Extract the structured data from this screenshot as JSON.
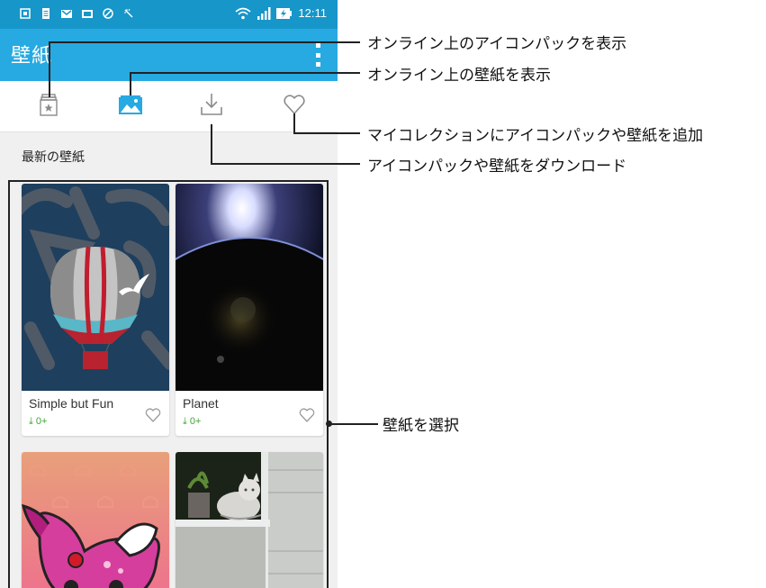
{
  "status_bar": {
    "time": "12:11",
    "icons": [
      "screenshot-icon",
      "doc-icon",
      "gmail-icon",
      "mail-icon",
      "dnd-icon",
      "clean-icon",
      "wifi-icon",
      "signal-icon",
      "battery-charging-icon"
    ]
  },
  "app_bar": {
    "title": "壁紙",
    "menu_icon": "overflow-menu-icon"
  },
  "tabs": [
    {
      "name": "icon-pack-tab",
      "icon": "icon-pack-icon",
      "active": false
    },
    {
      "name": "wallpaper-tab",
      "icon": "wallpaper-image-icon",
      "active": true
    },
    {
      "name": "download-tab",
      "icon": "download-icon",
      "active": false
    },
    {
      "name": "favorite-tab",
      "icon": "heart-icon",
      "active": false
    }
  ],
  "section": {
    "label": "最新の壁紙"
  },
  "cards": [
    {
      "title": "Simple but Fun",
      "downloads": "0+",
      "image": "hot-air-balloon-image"
    },
    {
      "title": "Planet",
      "downloads": "0+",
      "image": "planet-image"
    },
    {
      "title": "",
      "downloads": "",
      "image": "pink-monster-image"
    },
    {
      "title": "",
      "downloads": "",
      "image": "cat-on-window-image"
    }
  ],
  "callouts": {
    "icon_pack_online": "オンライン上のアイコンパックを表示",
    "wallpaper_online": "オンライン上の壁紙を表示",
    "add_to_collection": "マイコレクションにアイコンパックや壁紙を追加",
    "download": "アイコンパックや壁紙をダウンロード",
    "select_wallpaper": "壁紙を選択"
  },
  "colors": {
    "status_bar": "#1796c9",
    "app_bar": "#27a9e1",
    "active_tab": "#27a9e1",
    "inactive_tab": "#8a8a8a",
    "download_green": "#3fa535"
  }
}
